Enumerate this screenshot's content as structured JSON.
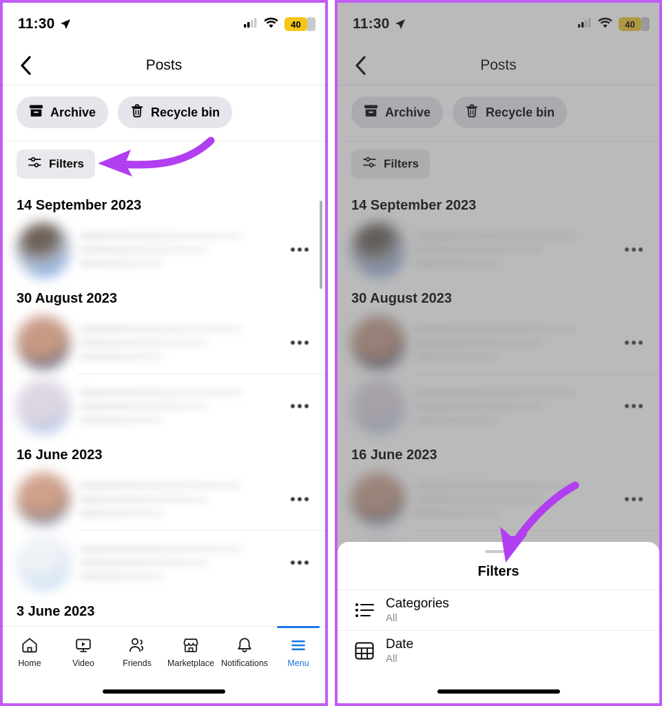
{
  "annotation": {
    "arrow_color": "#b13ef0",
    "frame_color": "#c15cf5",
    "left_arrow_points_to": "Filters",
    "right_arrow_points_to": "Filters sheet"
  },
  "status_bar": {
    "time": "11:30",
    "location_icon": "location-arrow-icon",
    "cellular_icon": "cellular-signal-icon",
    "wifi_icon": "wifi-icon",
    "battery_level": "40",
    "battery_color": "#f5c518"
  },
  "nav": {
    "back_icon": "chevron-left-icon",
    "title": "Posts"
  },
  "chips": [
    {
      "label": "Archive",
      "icon": "archive-box-icon"
    },
    {
      "label": "Recycle bin",
      "icon": "trash-icon"
    }
  ],
  "filters_button": {
    "label": "Filters",
    "icon": "sliders-icon"
  },
  "feed": {
    "groups": [
      {
        "date": "14 September 2023",
        "posts": [
          {
            "avatar": "av1",
            "menu_icon": "ellipsis-icon",
            "divider": false
          }
        ]
      },
      {
        "date": "30 August 2023",
        "posts": [
          {
            "avatar": "av2",
            "menu_icon": "ellipsis-icon",
            "divider": true
          },
          {
            "avatar": "av3",
            "menu_icon": "ellipsis-icon",
            "divider": false
          }
        ]
      },
      {
        "date": "16 June 2023",
        "posts": [
          {
            "avatar": "av4",
            "menu_icon": "ellipsis-icon",
            "divider": true
          },
          {
            "avatar": "av5",
            "menu_icon": "ellipsis-icon",
            "divider": false
          }
        ]
      },
      {
        "date": "3 June 2023",
        "posts": []
      }
    ]
  },
  "tabbar": {
    "active": "Menu",
    "active_color": "#1b74e4",
    "items": [
      {
        "label": "Home",
        "icon": "home-icon"
      },
      {
        "label": "Video",
        "icon": "video-icon"
      },
      {
        "label": "Friends",
        "icon": "friends-icon"
      },
      {
        "label": "Marketplace",
        "icon": "marketplace-icon"
      },
      {
        "label": "Notifications",
        "icon": "bell-icon"
      },
      {
        "label": "Menu",
        "icon": "hamburger-menu-icon"
      }
    ]
  },
  "filters_sheet": {
    "title": "Filters",
    "grabber": "sheet-grabber",
    "rows": [
      {
        "title": "Categories",
        "value": "All",
        "icon": "bullet-list-icon"
      },
      {
        "title": "Date",
        "value": "All",
        "icon": "calendar-grid-icon"
      }
    ]
  }
}
